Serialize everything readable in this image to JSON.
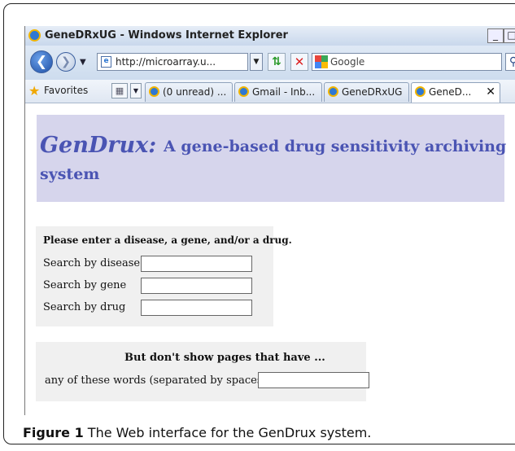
{
  "window": {
    "title": "GeneDRxUG - Windows Internet Explorer",
    "minimize_symbol": "_",
    "maximize_symbol": "□"
  },
  "toolbar": {
    "address": "http://microarray.u...",
    "search_placeholder": "Google",
    "icons": [
      "back-icon",
      "forward-icon",
      "refresh-icon",
      "stop-icon",
      "search-icon"
    ]
  },
  "favorites_bar": {
    "label": "Favorites",
    "tabs": [
      {
        "label": "(0 unread) ..."
      },
      {
        "label": "Gmail - Inb..."
      },
      {
        "label": "GeneDRxUG"
      },
      {
        "label": "GeneD...",
        "active": true
      }
    ]
  },
  "page": {
    "app_name": "GenDrux:",
    "tagline_part1": "A gene-based drug sensitivity archiving",
    "tagline_part2": "system",
    "search_panel": {
      "heading": "Please enter a disease, a gene, and/or a drug.",
      "fields": [
        {
          "label": "Search by disease",
          "value": ""
        },
        {
          "label": "Search by gene",
          "value": ""
        },
        {
          "label": "Search by drug",
          "value": ""
        }
      ]
    },
    "exclude_panel": {
      "heading": "But don't show pages that have ...",
      "label": "any of these words (separated by spaces)",
      "value": ""
    }
  },
  "caption": {
    "figure_label": "Figure 1",
    "text": "The Web interface for the GenDrux system."
  },
  "colors": {
    "banner_bg": "#d6d5ec",
    "banner_text": "#4a54b3",
    "panel_bg": "#f0f0f0"
  }
}
